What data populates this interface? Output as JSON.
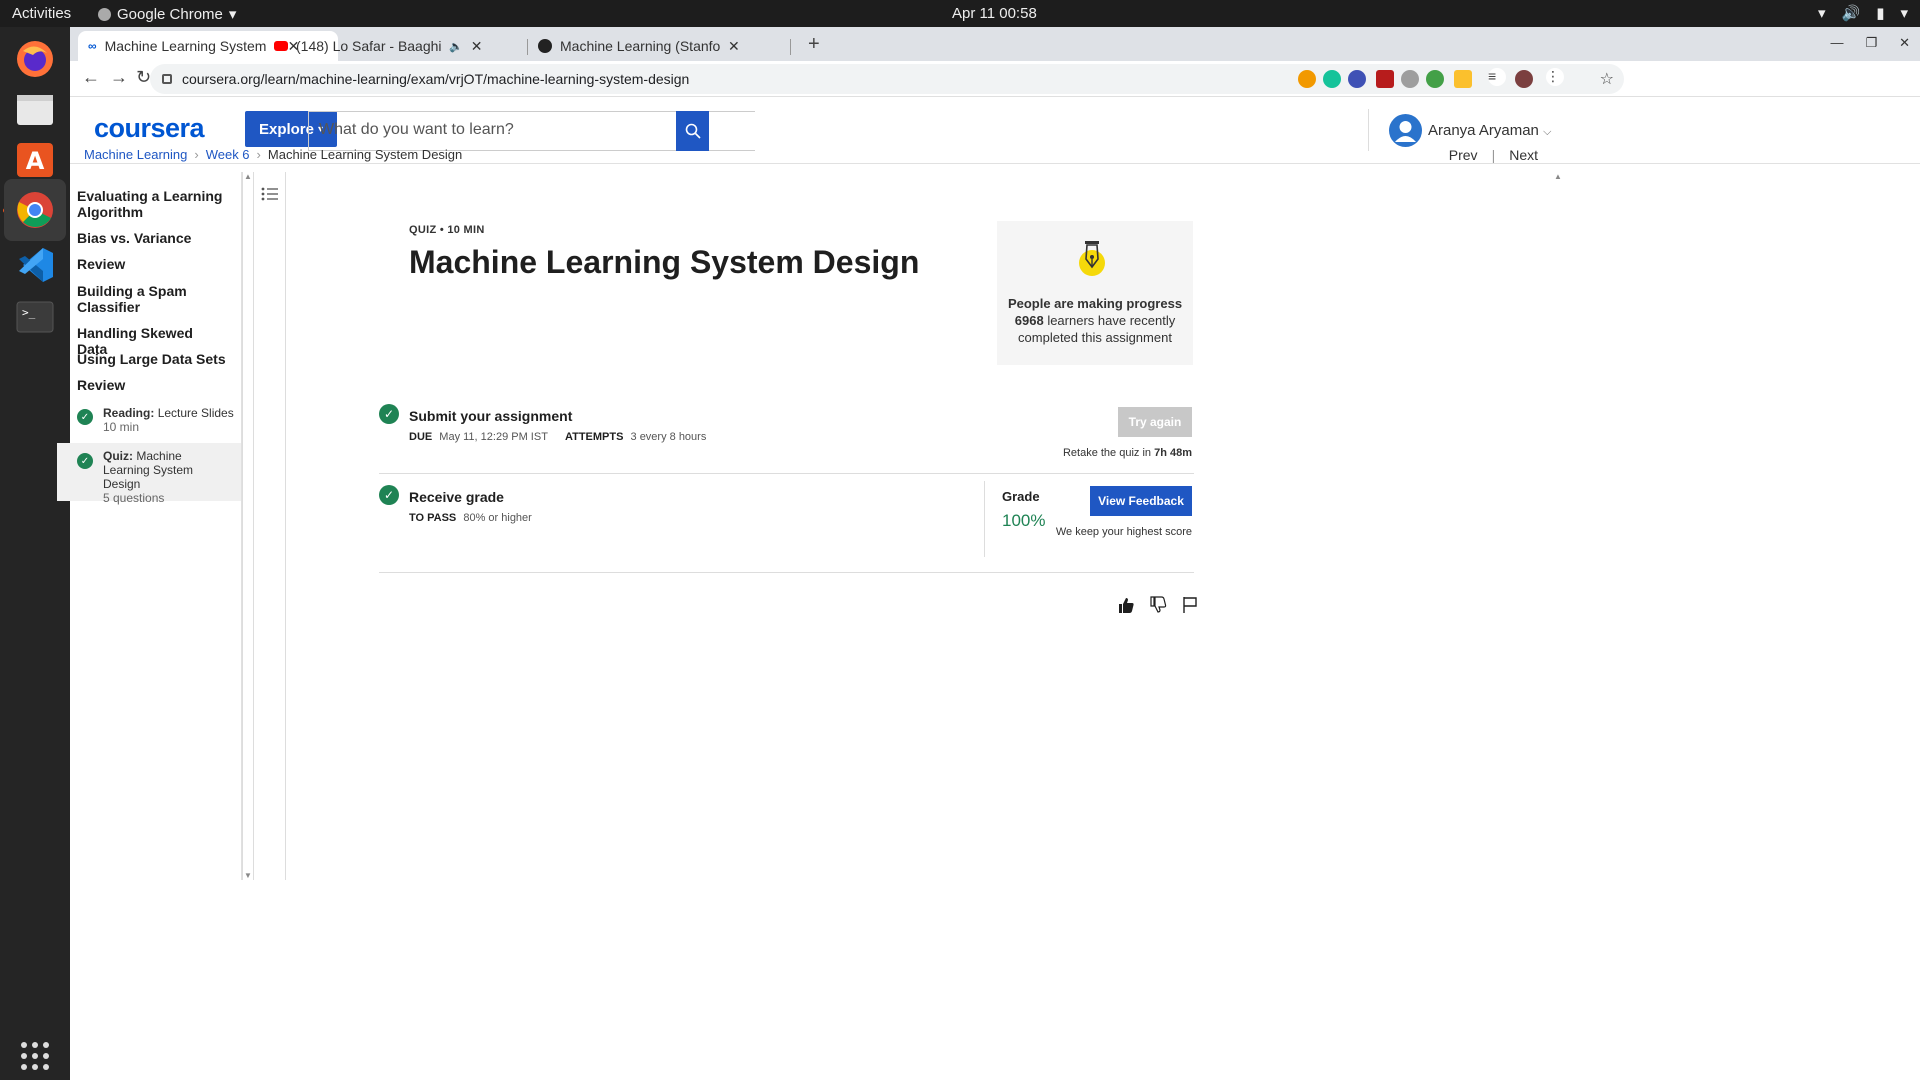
{
  "system": {
    "activities": "Activities",
    "app_name": "Google Chrome",
    "clock": "Apr 11  00:58"
  },
  "browser": {
    "tabs": [
      {
        "title": "Machine Learning System",
        "active": true
      },
      {
        "title": "(148) Lo Safar - Baaghi",
        "active": false
      },
      {
        "title": "Machine Learning (Stanfo",
        "active": false
      }
    ],
    "url": "coursera.org/learn/machine-learning/exam/vrjOT/machine-learning-system-design"
  },
  "header": {
    "logo": "coursera",
    "explore": "Explore",
    "search_placeholder": "What do you want to learn?",
    "user_name": "Aranya Aryaman"
  },
  "breadcrumb": {
    "items": [
      "Machine Learning",
      "Week 6"
    ],
    "current": "Machine Learning System Design",
    "prev": "Prev",
    "next": "Next"
  },
  "sidebar": {
    "headings": [
      "Evaluating a Learning Algorithm",
      "Bias vs. Variance",
      "Review",
      "Building a Spam Classifier",
      "Handling Skewed Data",
      "Using Large Data Sets",
      "Review"
    ],
    "items": [
      {
        "type": "Reading:",
        "title": "Lecture Slides",
        "meta": "10 min"
      },
      {
        "type": "Quiz:",
        "title": "Machine Learning System Design",
        "meta": "5 questions"
      }
    ]
  },
  "main": {
    "meta": "QUIZ • 10 MIN",
    "title": "Machine Learning System Design",
    "progress": {
      "heading": "People are making progress",
      "count": "6968",
      "text1": "learners have recently",
      "text2": "completed this assignment"
    },
    "submit": {
      "title": "Submit your assignment",
      "due_label": "DUE",
      "due_value": "May 11, 12:29 PM IST",
      "attempts_label": "ATTEMPTS",
      "attempts_value": "3 every 8 hours",
      "button": "Try again",
      "retake_text": "Retake the quiz in",
      "retake_time": "7h 48m"
    },
    "grade": {
      "title": "Receive grade",
      "pass_label": "TO PASS",
      "pass_value": "80% or higher",
      "grade_label": "Grade",
      "grade_value": "100%",
      "button": "View Feedback",
      "note": "We keep your highest score"
    }
  },
  "colors": {
    "brand": "#0056d2",
    "button": "#1f57c3",
    "success": "#1f8354"
  }
}
